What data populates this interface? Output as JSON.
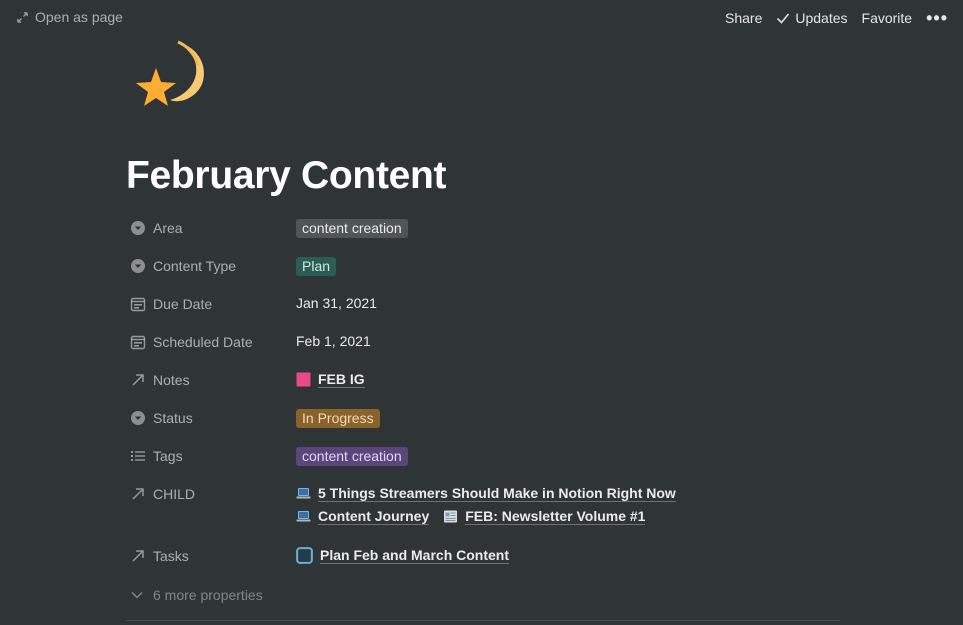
{
  "topbar": {
    "open_as_page": "Open as page",
    "share": "Share",
    "updates": "Updates",
    "favorite": "Favorite",
    "more": "•••"
  },
  "page": {
    "icon": "shooting-star-emoji",
    "title": "February Content"
  },
  "properties": [
    {
      "name": "Area",
      "icon": "select-icon",
      "type": "tag",
      "value": "content creation",
      "color": "#505558"
    },
    {
      "name": "Content Type",
      "icon": "select-icon",
      "type": "tag",
      "value": "Plan",
      "color": "#2b5d55"
    },
    {
      "name": "Due Date",
      "icon": "calendar-icon",
      "type": "text",
      "value": "Jan 31, 2021"
    },
    {
      "name": "Scheduled Date",
      "icon": "calendar-icon",
      "type": "text",
      "value": "Feb 1, 2021"
    },
    {
      "name": "Notes",
      "icon": "relation-arrow-icon",
      "type": "relation",
      "links": [
        {
          "label": "FEB IG",
          "icon": "pink-square-icon"
        }
      ]
    },
    {
      "name": "Status",
      "icon": "select-icon",
      "type": "tag",
      "value": "In Progress",
      "color": "#89632a"
    },
    {
      "name": "Tags",
      "icon": "list-icon",
      "type": "tag",
      "value": "content creation",
      "color": "#5a467a"
    },
    {
      "name": "CHILD",
      "icon": "relation-arrow-icon",
      "type": "relation",
      "links": [
        {
          "label": "5 Things Streamers Should Make in Notion Right Now",
          "icon": "laptop-icon"
        },
        {
          "label": "Content Journey",
          "icon": "laptop-icon"
        },
        {
          "label": "FEB: Newsletter Volume #1",
          "icon": "newspaper-icon"
        }
      ]
    },
    {
      "name": "Tasks",
      "icon": "relation-arrow-icon",
      "type": "relation",
      "links": [
        {
          "label": "Plan Feb and March Content",
          "icon": "checkbox-icon"
        }
      ]
    }
  ],
  "more_properties": "6 more properties"
}
